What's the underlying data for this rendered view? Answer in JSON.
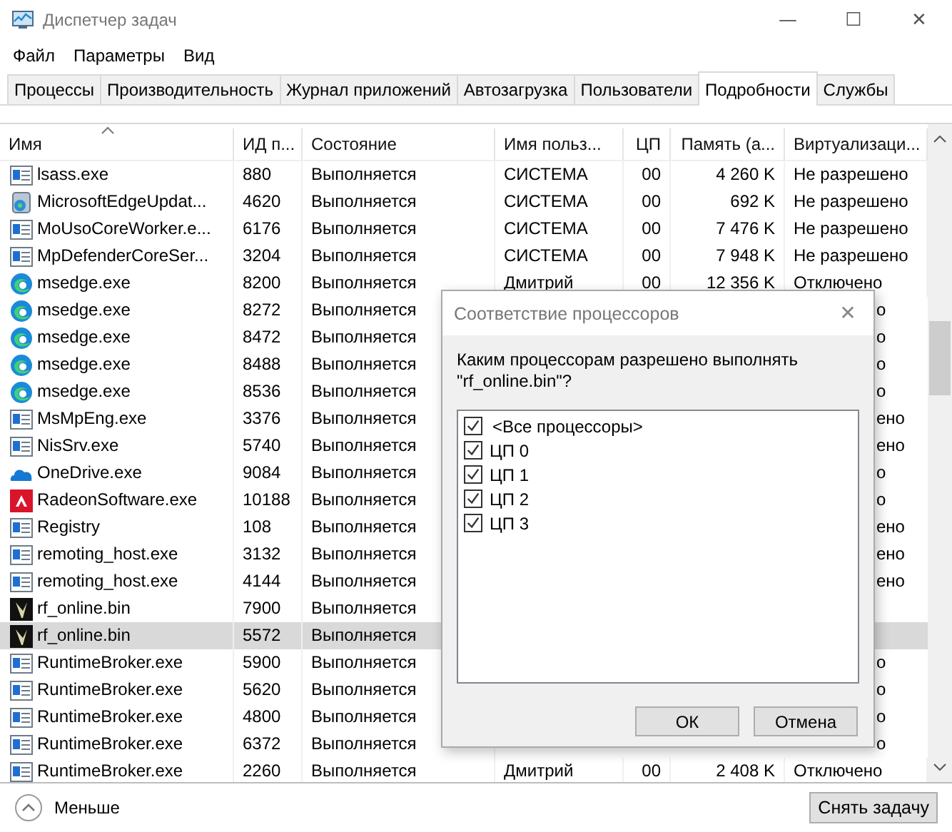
{
  "window": {
    "title": "Диспетчер задач",
    "controls": [
      "—",
      "☐",
      "✕"
    ]
  },
  "menu": [
    "Файл",
    "Параметры",
    "Вид"
  ],
  "tabs": [
    {
      "label": "Процессы",
      "selected": false
    },
    {
      "label": "Производительность",
      "selected": false
    },
    {
      "label": "Журнал приложений",
      "selected": false
    },
    {
      "label": "Автозагрузка",
      "selected": false
    },
    {
      "label": "Пользователи",
      "selected": false
    },
    {
      "label": "Подробности",
      "selected": true
    },
    {
      "label": "Службы",
      "selected": false
    }
  ],
  "table": {
    "columns": [
      "Имя",
      "ИД п...",
      "Состояние",
      "Имя польз...",
      "ЦП",
      "Память (а...",
      "Виртуализаци..."
    ],
    "rows": [
      {
        "kind": "app",
        "name": "lsass.exe",
        "pid": "880",
        "status": "Выполняется",
        "user": "СИСТЕМА",
        "cpu": "00",
        "memory": "4 260 K",
        "virtualization": "Не разрешено",
        "selected": false
      },
      {
        "kind": "updater",
        "name": "MicrosoftEdgeUpdat...",
        "pid": "4620",
        "status": "Выполняется",
        "user": "СИСТЕМА",
        "cpu": "00",
        "memory": "692 K",
        "virtualization": "Не разрешено",
        "selected": false
      },
      {
        "kind": "app",
        "name": "MoUsoCoreWorker.e...",
        "pid": "6176",
        "status": "Выполняется",
        "user": "СИСТЕМА",
        "cpu": "00",
        "memory": "7 476 K",
        "virtualization": "Не разрешено",
        "selected": false
      },
      {
        "kind": "app",
        "name": "MpDefenderCoreSer...",
        "pid": "3204",
        "status": "Выполняется",
        "user": "СИСТЕМА",
        "cpu": "00",
        "memory": "7 948 K",
        "virtualization": "Не разрешено",
        "selected": false
      },
      {
        "kind": "edge",
        "name": "msedge.exe",
        "pid": "8200",
        "status": "Выполняется",
        "user": "Дмитрий",
        "cpu": "00",
        "memory": "12 356 K",
        "virtualization": "Отключено",
        "selected": false
      },
      {
        "kind": "edge",
        "name": "msedge.exe",
        "pid": "8272",
        "status": "Выполняется",
        "virtualization": "о",
        "selected": false
      },
      {
        "kind": "edge",
        "name": "msedge.exe",
        "pid": "8472",
        "status": "Выполняется",
        "virtualization": "о",
        "selected": false
      },
      {
        "kind": "edge",
        "name": "msedge.exe",
        "pid": "8488",
        "status": "Выполняется",
        "virtualization": "о",
        "selected": false
      },
      {
        "kind": "edge",
        "name": "msedge.exe",
        "pid": "8536",
        "status": "Выполняется",
        "virtualization": "о",
        "selected": false
      },
      {
        "kind": "app",
        "name": "MsMpEng.exe",
        "pid": "3376",
        "status": "Выполняется",
        "virtualization": "ено",
        "selected": false
      },
      {
        "kind": "app",
        "name": "NisSrv.exe",
        "pid": "5740",
        "status": "Выполняется",
        "virtualization": "ено",
        "selected": false
      },
      {
        "kind": "onedrive",
        "name": "OneDrive.exe",
        "pid": "9084",
        "status": "Выполняется",
        "virtualization": "о",
        "selected": false
      },
      {
        "kind": "radeon",
        "name": "RadeonSoftware.exe",
        "pid": "10188",
        "status": "Выполняется",
        "virtualization": "о",
        "selected": false
      },
      {
        "kind": "app",
        "name": "Registry",
        "pid": "108",
        "status": "Выполняется",
        "virtualization": "ено",
        "selected": false
      },
      {
        "kind": "app",
        "name": "remoting_host.exe",
        "pid": "3132",
        "status": "Выполняется",
        "virtualization": "ено",
        "selected": false
      },
      {
        "kind": "app",
        "name": "remoting_host.exe",
        "pid": "4144",
        "status": "Выполняется",
        "virtualization": "ено",
        "selected": false
      },
      {
        "kind": "game",
        "name": "rf_online.bin",
        "pid": "7900",
        "status": "Выполняется",
        "selected": false
      },
      {
        "kind": "game",
        "name": "rf_online.bin",
        "pid": "5572",
        "status": "Выполняется",
        "selected": true
      },
      {
        "kind": "app",
        "name": "RuntimeBroker.exe",
        "pid": "5900",
        "status": "Выполняется",
        "virtualization": "о",
        "selected": false
      },
      {
        "kind": "app",
        "name": "RuntimeBroker.exe",
        "pid": "5620",
        "status": "Выполняется",
        "virtualization": "о",
        "selected": false
      },
      {
        "kind": "app",
        "name": "RuntimeBroker.exe",
        "pid": "4800",
        "status": "Выполняется",
        "virtualization": "о",
        "selected": false
      },
      {
        "kind": "app",
        "name": "RuntimeBroker.exe",
        "pid": "6372",
        "status": "Выполняется",
        "virtualization": "о",
        "selected": false
      },
      {
        "kind": "app",
        "name": "RuntimeBroker.exe",
        "pid": "2260",
        "status": "Выполняется",
        "user": "Дмитрий",
        "cpu": "00",
        "memory": "2 408 K",
        "virtualization": "Отключено",
        "selected": false
      }
    ]
  },
  "dialog": {
    "title": "Соответствие процессоров",
    "close": "✕",
    "question": "Каким процессорам разрешено выполнять \"rf_online.bin\"?",
    "options": [
      {
        "label": "<Все процессоры>",
        "checked": true
      },
      {
        "label": "ЦП 0",
        "checked": true
      },
      {
        "label": "ЦП 1",
        "checked": true
      },
      {
        "label": "ЦП 2",
        "checked": true
      },
      {
        "label": "ЦП 3",
        "checked": true
      }
    ],
    "buttons": [
      "ОК",
      "Отмена"
    ]
  },
  "footer": {
    "less": "Меньше",
    "end_task": "Снять задачу"
  }
}
